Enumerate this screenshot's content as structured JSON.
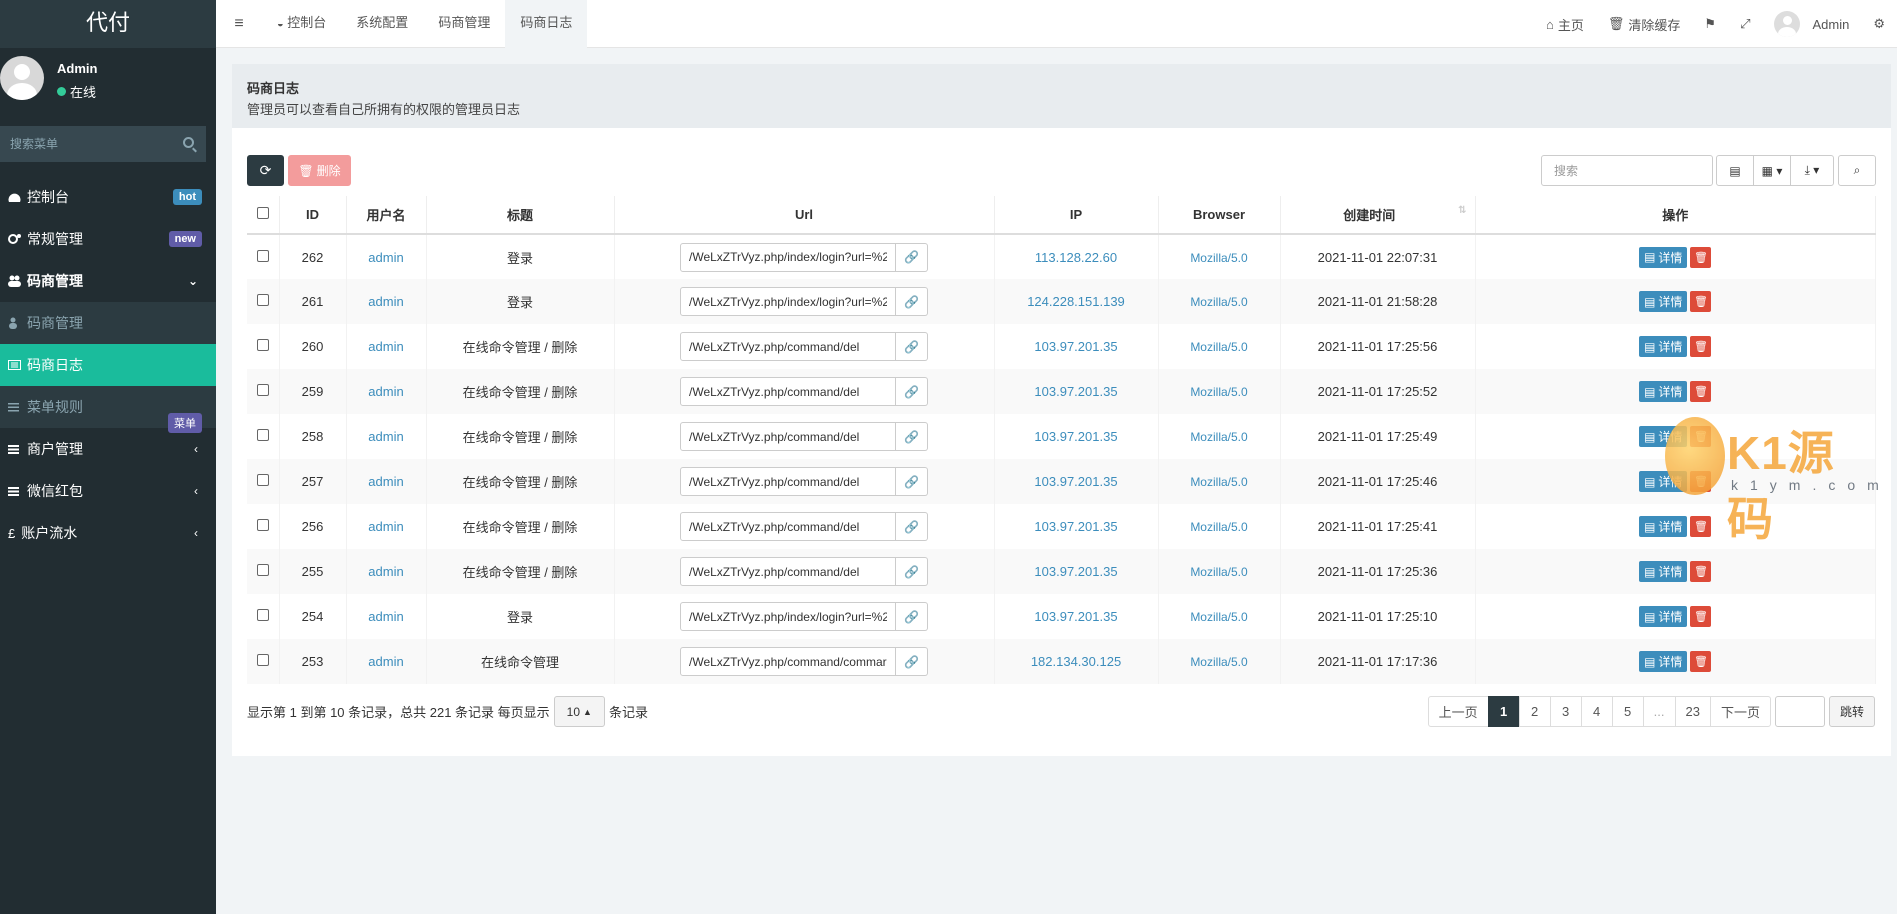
{
  "app": {
    "logo": "代付"
  },
  "user": {
    "name": "Admin",
    "status": "在线"
  },
  "sidebar": {
    "search_placeholder": "搜索菜单",
    "items": [
      {
        "label": "控制台",
        "badge": "hot"
      },
      {
        "label": "常规管理",
        "badge": "new"
      },
      {
        "label": "码商管理"
      },
      {
        "label": "码商管理"
      },
      {
        "label": "码商日志"
      },
      {
        "label": "菜单规则",
        "badge": "菜单"
      },
      {
        "label": "商户管理"
      },
      {
        "label": "微信红包"
      },
      {
        "label": "账户流水"
      }
    ]
  },
  "topbar": {
    "tabs": [
      "控制台",
      "系统配置",
      "码商管理",
      "码商日志"
    ],
    "home": "主页",
    "clear_cache": "清除缓存",
    "user": "Admin"
  },
  "header": {
    "title": "码商日志",
    "subtitle": "管理员可以查看自己所拥有的权限的管理员日志"
  },
  "toolbar": {
    "delete": "删除",
    "search_placeholder": "搜索"
  },
  "table": {
    "columns": [
      "ID",
      "用户名",
      "标题",
      "Url",
      "IP",
      "Browser",
      "创建时间",
      "操作"
    ],
    "detail_label": "详情",
    "rows": [
      {
        "id": "262",
        "user": "admin",
        "title": "登录",
        "url": "/WeLxZTrVyz.php/index/login?url=%2",
        "ip": "113.128.22.60",
        "browser": "Mozilla/5.0",
        "time": "2021-11-01 22:07:31"
      },
      {
        "id": "261",
        "user": "admin",
        "title": "登录",
        "url": "/WeLxZTrVyz.php/index/login?url=%2",
        "ip": "124.228.151.139",
        "browser": "Mozilla/5.0",
        "time": "2021-11-01 21:58:28"
      },
      {
        "id": "260",
        "user": "admin",
        "title": "在线命令管理 / 删除",
        "url": "/WeLxZTrVyz.php/command/del",
        "ip": "103.97.201.35",
        "browser": "Mozilla/5.0",
        "time": "2021-11-01 17:25:56"
      },
      {
        "id": "259",
        "user": "admin",
        "title": "在线命令管理 / 删除",
        "url": "/WeLxZTrVyz.php/command/del",
        "ip": "103.97.201.35",
        "browser": "Mozilla/5.0",
        "time": "2021-11-01 17:25:52"
      },
      {
        "id": "258",
        "user": "admin",
        "title": "在线命令管理 / 删除",
        "url": "/WeLxZTrVyz.php/command/del",
        "ip": "103.97.201.35",
        "browser": "Mozilla/5.0",
        "time": "2021-11-01 17:25:49"
      },
      {
        "id": "257",
        "user": "admin",
        "title": "在线命令管理 / 删除",
        "url": "/WeLxZTrVyz.php/command/del",
        "ip": "103.97.201.35",
        "browser": "Mozilla/5.0",
        "time": "2021-11-01 17:25:46"
      },
      {
        "id": "256",
        "user": "admin",
        "title": "在线命令管理 / 删除",
        "url": "/WeLxZTrVyz.php/command/del",
        "ip": "103.97.201.35",
        "browser": "Mozilla/5.0",
        "time": "2021-11-01 17:25:41"
      },
      {
        "id": "255",
        "user": "admin",
        "title": "在线命令管理 / 删除",
        "url": "/WeLxZTrVyz.php/command/del",
        "ip": "103.97.201.35",
        "browser": "Mozilla/5.0",
        "time": "2021-11-01 17:25:36"
      },
      {
        "id": "254",
        "user": "admin",
        "title": "登录",
        "url": "/WeLxZTrVyz.php/index/login?url=%2",
        "ip": "103.97.201.35",
        "browser": "Mozilla/5.0",
        "time": "2021-11-01 17:25:10"
      },
      {
        "id": "253",
        "user": "admin",
        "title": "在线命令管理",
        "url": "/WeLxZTrVyz.php/command/commar",
        "ip": "182.134.30.125",
        "browser": "Mozilla/5.0",
        "time": "2021-11-01 17:17:36"
      }
    ]
  },
  "pagination": {
    "info_prefix": "显示第 1 到第 10 条记录，总共 221 条记录 每页显示",
    "page_size": "10",
    "info_suffix": "条记录",
    "prev": "上一页",
    "pages": [
      "1",
      "2",
      "3",
      "4",
      "5",
      "...",
      "23"
    ],
    "next": "下一页",
    "jump": "跳转"
  },
  "watermark": {
    "text": "K1源码",
    "sub": "k1ym.com"
  }
}
